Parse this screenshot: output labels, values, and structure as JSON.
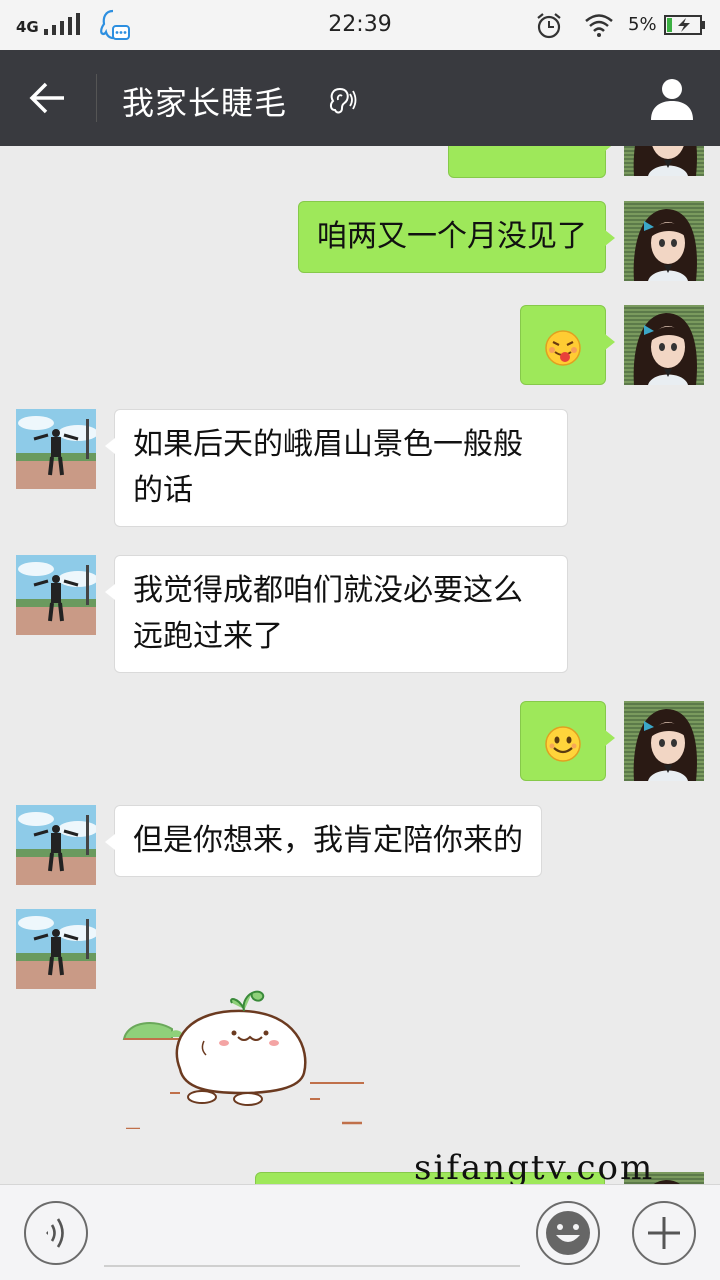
{
  "status_bar": {
    "network": "4G",
    "time": "22:39",
    "battery_percent": "5%"
  },
  "header": {
    "title": "我家长睫毛",
    "icons": [
      "back-arrow-icon",
      "ear-icon",
      "profile-icon"
    ]
  },
  "messages": [
    {
      "sender": "me",
      "text": ""
    },
    {
      "sender": "me",
      "text": "咱两又一个月没见了"
    },
    {
      "sender": "me",
      "emoji": "tongue-out-emoji"
    },
    {
      "sender": "them",
      "lines": [
        "如果后天的峨眉山景色一般般",
        "的话"
      ]
    },
    {
      "sender": "them",
      "lines": [
        "我觉得成都咱们就没必要这么",
        "远跑过来了"
      ]
    },
    {
      "sender": "me",
      "emoji": "smile-emoji"
    },
    {
      "sender": "them",
      "text": "但是你想来，我肯定陪你来的"
    },
    {
      "sender": "them",
      "sticker": "white-blob-sticker"
    },
    {
      "sender": "me",
      "text": ""
    }
  ],
  "watermark": "sifangtv.com",
  "input_bar": {
    "placeholder": "",
    "icons": [
      "voice-icon",
      "emoji-icon",
      "plus-icon"
    ]
  },
  "colors": {
    "title_bar": "#393a3f",
    "my_bubble": "#9ee85a",
    "their_bubble": "#ffffff",
    "background": "#ebebeb"
  }
}
